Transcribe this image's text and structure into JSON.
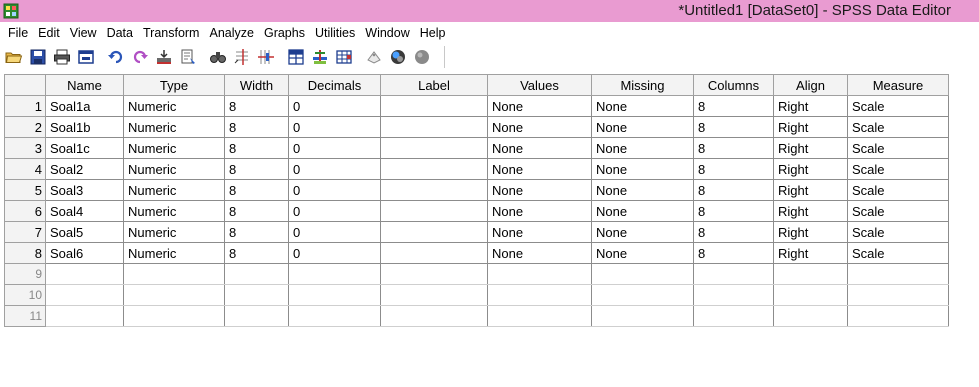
{
  "window": {
    "title": "*Untitled1 [DataSet0] - SPSS Data Editor",
    "title_bar_color": "#e99bd1"
  },
  "menu": {
    "items": [
      "File",
      "Edit",
      "View",
      "Data",
      "Transform",
      "Analyze",
      "Graphs",
      "Utilities",
      "Window",
      "Help"
    ]
  },
  "toolbar": {
    "icons": [
      "open-folder-icon",
      "save-icon",
      "print-icon",
      "dialog-recall-icon",
      "undo-icon",
      "redo-icon",
      "goto-case-icon",
      "variables-icon",
      "find-icon",
      "insert-cases-icon",
      "insert-variable-icon",
      "split-file-icon",
      "weight-cases-icon",
      "select-cases-icon",
      "value-labels-icon",
      "use-sets-icon",
      "show-all-variables-icon"
    ]
  },
  "grid": {
    "columns": [
      "Name",
      "Type",
      "Width",
      "Decimals",
      "Label",
      "Values",
      "Missing",
      "Columns",
      "Align",
      "Measure"
    ],
    "rows": [
      {
        "num": "1",
        "cells": [
          "Soal1a",
          "Numeric",
          "8",
          "0",
          "",
          "None",
          "None",
          "8",
          "Right",
          "Scale"
        ]
      },
      {
        "num": "2",
        "cells": [
          "Soal1b",
          "Numeric",
          "8",
          "0",
          "",
          "None",
          "None",
          "8",
          "Right",
          "Scale"
        ]
      },
      {
        "num": "3",
        "cells": [
          "Soal1c",
          "Numeric",
          "8",
          "0",
          "",
          "None",
          "None",
          "8",
          "Right",
          "Scale"
        ]
      },
      {
        "num": "4",
        "cells": [
          "Soal2",
          "Numeric",
          "8",
          "0",
          "",
          "None",
          "None",
          "8",
          "Right",
          "Scale"
        ]
      },
      {
        "num": "5",
        "cells": [
          "Soal3",
          "Numeric",
          "8",
          "0",
          "",
          "None",
          "None",
          "8",
          "Right",
          "Scale"
        ]
      },
      {
        "num": "6",
        "cells": [
          "Soal4",
          "Numeric",
          "8",
          "0",
          "",
          "None",
          "None",
          "8",
          "Right",
          "Scale"
        ]
      },
      {
        "num": "7",
        "cells": [
          "Soal5",
          "Numeric",
          "8",
          "0",
          "",
          "None",
          "None",
          "8",
          "Right",
          "Scale"
        ]
      },
      {
        "num": "8",
        "cells": [
          "Soal6",
          "Numeric",
          "8",
          "0",
          "",
          "None",
          "None",
          "8",
          "Right",
          "Scale"
        ]
      }
    ],
    "empty_rows": [
      "9",
      "10",
      "11"
    ]
  }
}
